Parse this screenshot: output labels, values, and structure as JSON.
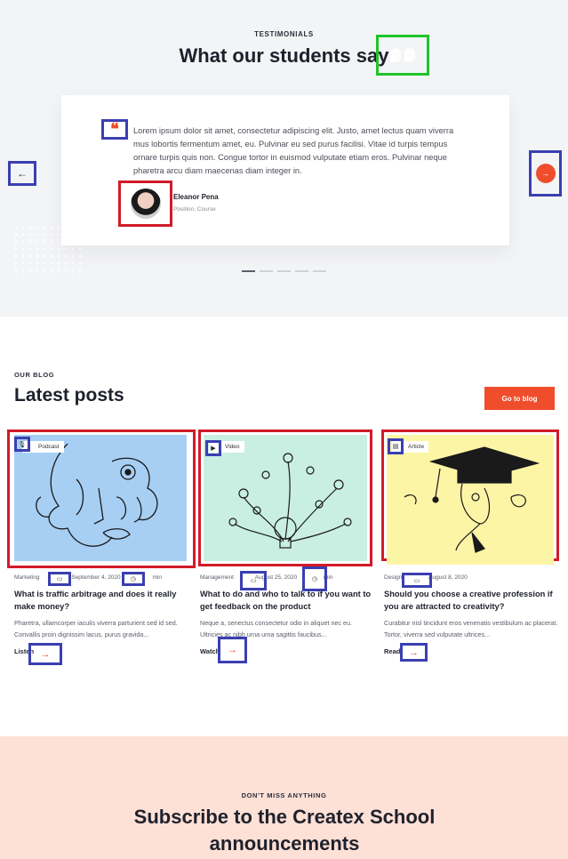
{
  "testimonials": {
    "eyebrow": "TESTIMONIALS",
    "title": "What our students say",
    "quote": "Lorem ipsum dolor sit amet, consectetur adipiscing elit. Justo, amet lectus quam viverra mus lobortis fermentum amet, eu. Pulvinar eu sed purus facilisi. Vitae id turpis tempus ornare turpis quis non. Congue tortor in euismod vulputate etiam eros. Pulvinar neque pharetra arcu diam maecenas diam integer in.",
    "author": "Eleanor Pena",
    "role": "Position, Course",
    "prev_arrow": "←",
    "next_arrow": "→",
    "pages": 5,
    "active_page": 1
  },
  "blog": {
    "eyebrow": "OUR BLOG",
    "title": "Latest posts",
    "button": "Go to blog",
    "posts": [
      {
        "tag": "Podcast",
        "category": "Marketing",
        "date": "September 4, 2020",
        "duration": "min",
        "title": "What is traffic arbitrage and does it really make money?",
        "excerpt": "Pharetra, ullamcorper iaculis viverra parturient sed id sed. Convallis proin dignissim lacus, purus gravida...",
        "link": "Listen",
        "image_color": "#a7cff4"
      },
      {
        "tag": "Video",
        "category": "Management",
        "date": "August 25, 2020",
        "duration": "min",
        "title": "What to do and who to talk to if you want to get feedback on the product",
        "excerpt": "Neque a, senectus consectetur odio in aliquet nec eu. Ultricies ac nibh urna urna sagittis faucibus...",
        "link": "Watch",
        "image_color": "#c9efe3"
      },
      {
        "tag": "Article",
        "category": "Design",
        "date": "August 8, 2020",
        "title": "Should you choose a creative profession if you are attracted to creativity?",
        "excerpt": "Curabitur nisl tincidunt eros venenatis vestibulum ac placerat. Tortor, viverra sed vulputate ultrices...",
        "link": "Read",
        "image_color": "#fdf5a6"
      }
    ]
  },
  "subscribe": {
    "eyebrow": "DON'T MISS ANYTHING",
    "title": "Subscribe to the Createx School announcements"
  },
  "colors": {
    "accent": "#ef4d2c",
    "annotation_blue": "#3b3fb1",
    "annotation_red": "#d11b28",
    "annotation_green": "#1fc42a"
  }
}
